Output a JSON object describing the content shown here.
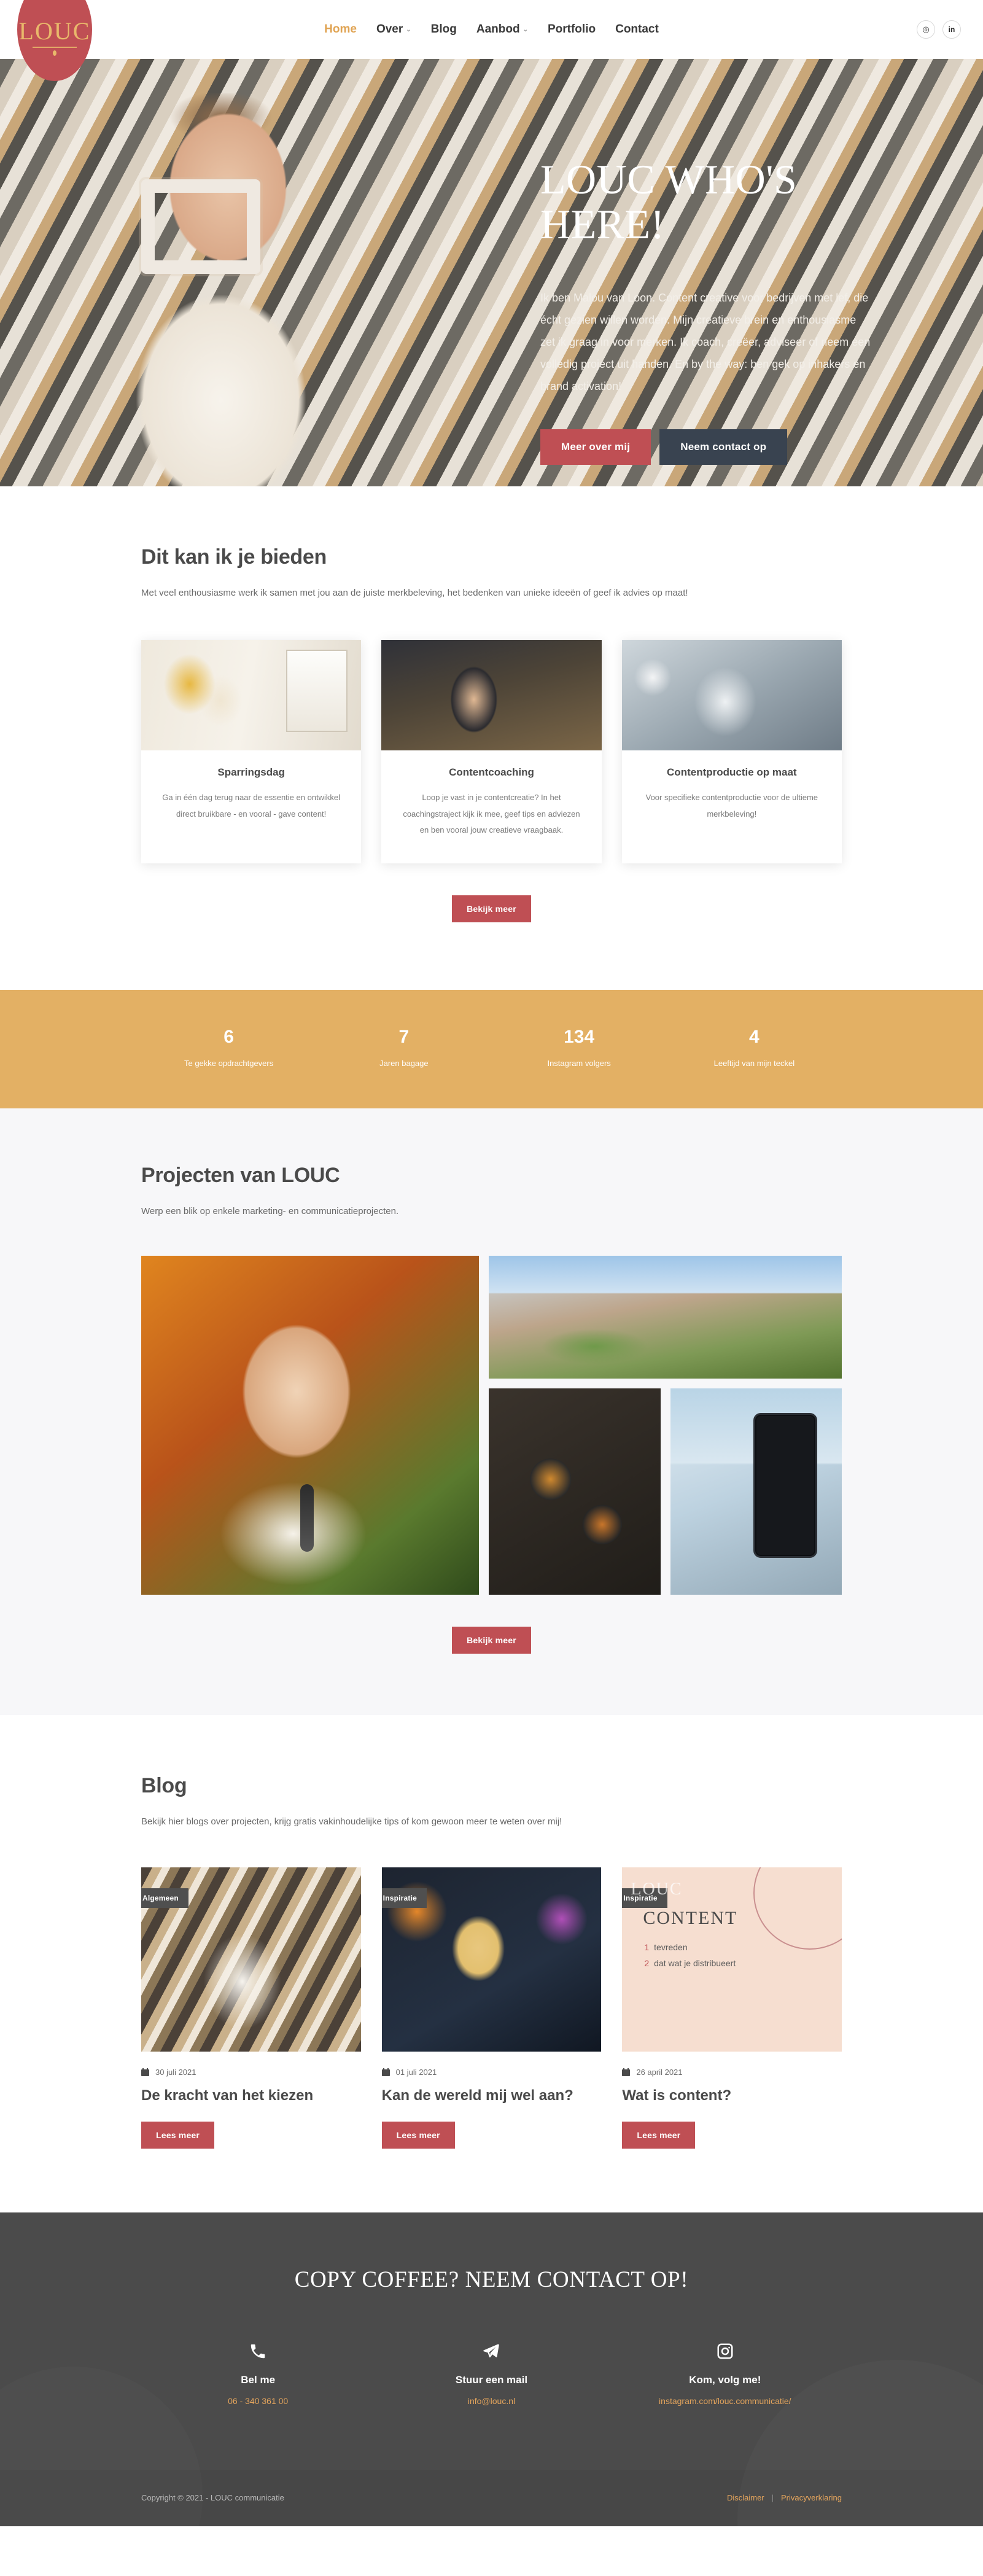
{
  "brand": {
    "logo_text": "LOUC"
  },
  "nav": {
    "items": [
      {
        "label": "Home",
        "has_caret": false,
        "active": true
      },
      {
        "label": "Over",
        "has_caret": true,
        "active": false
      },
      {
        "label": "Blog",
        "has_caret": false,
        "active": false
      },
      {
        "label": "Aanbod",
        "has_caret": true,
        "active": false
      },
      {
        "label": "Portfolio",
        "has_caret": false,
        "active": false
      },
      {
        "label": "Contact",
        "has_caret": false,
        "active": false
      }
    ],
    "caret": "⌄",
    "socials": [
      {
        "name": "instagram-icon",
        "glyph": "◎"
      },
      {
        "name": "linkedin-icon",
        "glyph": "in"
      }
    ]
  },
  "hero": {
    "title": "LOUC WHO'S HERE!",
    "paragraph": "Ik ben Malou van Loon. Content creative voor bedrijven met lef, die écht gezien willen worden. Mijn creatieve brein en enthousiasme zet ik graag in voor merken. Ik coach, creëer, adviseer of neem een volledig project uit handen. En by the way: ben gek op inhakers en brand activation!",
    "primary_button": "Meer over mij",
    "secondary_button": "Neem contact op"
  },
  "services": {
    "title": "Dit kan ik je bieden",
    "subtitle": "Met veel enthousiasme werk ik samen met jou aan de juiste merkbeleving, het bedenken van unieke ideeën of geef ik advies op maat!",
    "cards": [
      {
        "title": "Sparringsdag",
        "text": "Ga in één dag terug naar de essentie en ontwikkel direct bruikbare - en vooral - gave content!"
      },
      {
        "title": "Contentcoaching",
        "text": "Loop je vast in je contentcreatie? In het coachingstraject kijk ik mee, geef tips en adviezen en ben vooral jouw creatieve vraagbaak."
      },
      {
        "title": "Contentproductie op maat",
        "text": "Voor specifieke contentproductie voor de ultieme merkbeleving!"
      }
    ],
    "button": "Bekijk meer"
  },
  "stats": {
    "items": [
      {
        "value": "6",
        "label": "Te gekke opdrachtgevers"
      },
      {
        "value": "7",
        "label": "Jaren bagage"
      },
      {
        "value": "134",
        "label": "Instagram volgers"
      },
      {
        "value": "4",
        "label": "Leeftijd van mijn teckel"
      }
    ]
  },
  "projects": {
    "title": "Projecten van LOUC",
    "subtitle": "Werp een blik op enkele marketing- en communicatieprojecten.",
    "button": "Bekijk meer"
  },
  "blog": {
    "title": "Blog",
    "subtitle": "Bekijk hier blogs over projecten, krijg gratis vakinhoudelijke tips of kom gewoon meer te weten over mij!",
    "posts": [
      {
        "badge": "Algemeen",
        "date": "30 juli 2021",
        "title": "De kracht van het kiezen",
        "button": "Lees meer"
      },
      {
        "badge": "Inspiratie",
        "date": "01 juli 2021",
        "title": "Kan de wereld mij wel aan?",
        "button": "Lees meer"
      },
      {
        "badge": "Inspiratie",
        "date": "26 april 2021",
        "title": "Wat is content?",
        "button": "Lees meer"
      }
    ],
    "thumb3": {
      "logo": "LOUC",
      "heading": "CONTENT",
      "line1_num": "1",
      "line1_text": "tevreden",
      "line2_num": "2",
      "line2_text": "dat wat je distribueert"
    }
  },
  "footer": {
    "title": "COPY COFFEE? NEEM CONTACT OP!",
    "columns": [
      {
        "icon": "phone-icon",
        "label": "Bel me",
        "value": "06 - 340 361 00"
      },
      {
        "icon": "paper-plane-icon",
        "label": "Stuur een mail",
        "value": "info@louc.nl"
      },
      {
        "icon": "instagram-icon",
        "label": "Kom, volg me!",
        "value": "instagram.com/louc.communicatie/"
      }
    ],
    "copyright": "Copyright © 2021 - LOUC communicatie",
    "links": [
      "Disclaimer",
      "Privacyverklaring"
    ],
    "link_separator": "|"
  },
  "colors": {
    "accent_red": "#bf4f54",
    "accent_gold": "#e3b064",
    "dark_navy": "#394350",
    "footer_bg": "#4b4b4b",
    "link_gold": "#e3a45c"
  }
}
